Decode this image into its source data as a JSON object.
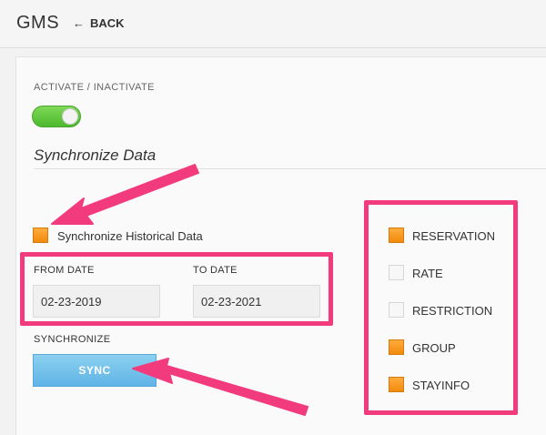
{
  "header": {
    "title": "GMS",
    "back_label": "BACK"
  },
  "activate": {
    "label": "ACTIVATE / INACTIVATE",
    "enabled": true
  },
  "sync_section": {
    "title": "Synchronize Data"
  },
  "historical": {
    "label": "Synchronize Historical Data",
    "checked": true
  },
  "dates": {
    "from_label": "FROM DATE",
    "from_value": "02-23-2019",
    "to_label": "TO DATE",
    "to_value": "02-23-2021"
  },
  "synchronize": {
    "label": "SYNCHRONIZE",
    "button_label": "SYNC"
  },
  "options": [
    {
      "label": "RESERVATION",
      "checked": true
    },
    {
      "label": "RATE",
      "checked": false
    },
    {
      "label": "RESTRICTION",
      "checked": false
    },
    {
      "label": "GROUP",
      "checked": true
    },
    {
      "label": "STAYINFO",
      "checked": true
    }
  ],
  "colors": {
    "accent": "#f23b7c",
    "toggle_on": "#4cb82e",
    "checkbox_checked": "#f28a0c",
    "sync_button": "#5fb4e6"
  }
}
